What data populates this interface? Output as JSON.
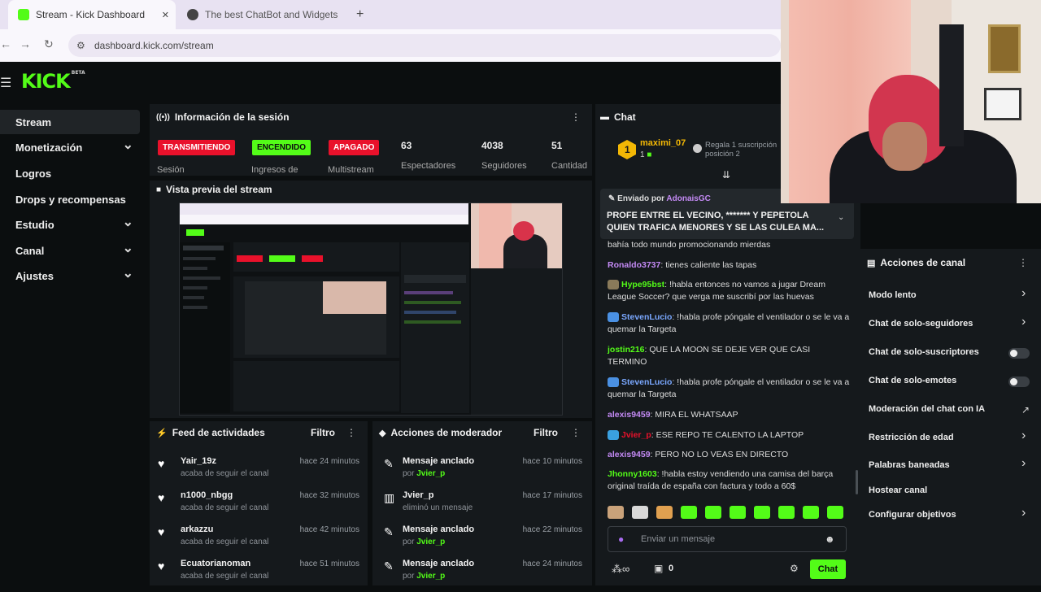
{
  "browser": {
    "tabs": [
      {
        "label": "Stream - Kick Dashboard",
        "active": true
      },
      {
        "label": "The best ChatBot and Widgets",
        "active": false
      }
    ],
    "new_tab": "+",
    "close": "✕",
    "url": "dashboard.kick.com/stream"
  },
  "kick": {
    "logo": "KICK",
    "logo_sup": "BETA"
  },
  "sidebar": {
    "items": [
      {
        "label": "Stream",
        "selected": true,
        "chevron": false
      },
      {
        "label": "Monetización",
        "chevron": true
      },
      {
        "label": "Logros",
        "chevron": false
      },
      {
        "label": "Drops y recompensas",
        "chevron": false
      },
      {
        "label": "Estudio",
        "chevron": true
      },
      {
        "label": "Canal",
        "chevron": true
      },
      {
        "label": "Ajustes",
        "chevron": true
      }
    ]
  },
  "session": {
    "title": "Información de la sesión",
    "badges": [
      {
        "label": "TRANSMITIENDO",
        "color": "#e9112b",
        "text_color": "#ffffff"
      },
      {
        "label": "ENCENDIDO",
        "color": "#53fc18",
        "text_color": "#0b0e0f"
      },
      {
        "label": "APAGADO",
        "color": "#e9112b",
        "text_color": "#ffffff"
      }
    ],
    "badge_labels": [
      "Sesión",
      "Ingresos de",
      "Multistream"
    ],
    "stats": [
      {
        "value": "63",
        "label": "Espectadores"
      },
      {
        "value": "4038",
        "label": "Seguidores"
      },
      {
        "value": "51",
        "label": "Cantidad"
      }
    ]
  },
  "preview": {
    "title": "Vista previa del stream"
  },
  "activity": {
    "title": "Feed de actividades",
    "filter": "Filtro",
    "items": [
      {
        "name": "Yair_19z",
        "sub": "acaba de seguir el canal",
        "time": "hace 24 minutos"
      },
      {
        "name": "n1000_nbgg",
        "sub": "acaba de seguir el canal",
        "time": "hace 32 minutos"
      },
      {
        "name": "arkazzu",
        "sub": "acaba de seguir el canal",
        "time": "hace 42 minutos"
      },
      {
        "name": "Ecuatorianoman",
        "sub": "acaba de seguir el canal",
        "time": "hace 51 minutos"
      }
    ]
  },
  "modactions": {
    "title": "Acciones de moderador",
    "filter": "Filtro",
    "items": [
      {
        "name": "Mensaje anclado",
        "prefix": "por ",
        "user": "Jvier_p",
        "sub": "",
        "time": "hace 10 minutos",
        "icon": "pin-icon"
      },
      {
        "name": "Jvier_p",
        "prefix": "",
        "user": "",
        "sub": "eliminó un mensaje",
        "time": "hace 17 minutos",
        "icon": "trash-icon"
      },
      {
        "name": "Mensaje anclado",
        "prefix": "por ",
        "user": "Jvier_p",
        "sub": "",
        "time": "hace 22 minutos",
        "icon": "pin-icon"
      },
      {
        "name": "Mensaje anclado",
        "prefix": "por ",
        "user": "Jvier_p",
        "sub": "",
        "time": "hace 24 minutos",
        "icon": "pin-icon"
      }
    ]
  },
  "chat": {
    "title": "Chat",
    "gifter": {
      "name": "maximi_07",
      "count": "1",
      "note": "Regala 1 suscripción",
      "note2": "posición 2"
    },
    "pinned": {
      "label": "Enviado por",
      "user": "AdonaisGC",
      "text": "PROFE ENTRE EL VECINO, ******* Y PEPETOLA QUIEN TRAFICA MENORES Y SE LAS CULEA MA..."
    },
    "messages": [
      {
        "user": "",
        "color": "#dddddd",
        "text": "bahía todo mundo promocionando mierdas"
      },
      {
        "user": "Ronaldo3737",
        "color": "#c48af5",
        "text": "tienes caliente las tapas"
      },
      {
        "user": "Hype95bst",
        "color": "#53fc18",
        "text": "!habla entonces no vamos a jugar Dream League Soccer? que verga me suscribí por las huevas"
      },
      {
        "user": "StevenLucio",
        "color": "#7aa8ff",
        "text": "!habla profe póngale el ventilador o se le va a quemar la Targeta"
      },
      {
        "user": "jostin216",
        "color": "#53fc18",
        "text": "QUE LA MOON SE DEJE VER QUE CASI TERMINO"
      },
      {
        "user": "StevenLucio",
        "color": "#7aa8ff",
        "text": "!habla profe póngale el ventilador o se le va a quemar la Targeta"
      },
      {
        "user": "alexis9459",
        "color": "#c48af5",
        "text": "MIRA EL WHATSAAP"
      },
      {
        "user": "Jvier_p",
        "color": "#e9112b",
        "text": "ESE REPO TE CALENTO LA LAPTOP"
      },
      {
        "user": "alexis9459",
        "color": "#c48af5",
        "text": "PERO NO LO VEAS EN DIRECTO"
      },
      {
        "user": "Jhonny1603",
        "color": "#53fc18",
        "text": "!habla estoy vendiendo una camisa del barça original traída de españa con factura y todo a 60$"
      }
    ],
    "input_placeholder": "Enviar un mensaje",
    "points": "0",
    "send": "Chat"
  },
  "channel_actions": {
    "title": "Acciones de canal",
    "items": [
      {
        "label": "Modo lento",
        "kind": "chevron"
      },
      {
        "label": "Chat de solo-seguidores",
        "kind": "chevron"
      },
      {
        "label": "Chat de solo-suscriptores",
        "kind": "toggle"
      },
      {
        "label": "Chat de solo-emotes",
        "kind": "toggle"
      },
      {
        "label": "Moderación del chat con IA",
        "kind": "external"
      },
      {
        "label": "Restricción de edad",
        "kind": "chevron"
      },
      {
        "label": "Palabras baneadas",
        "kind": "chevron"
      },
      {
        "label": "Hostear canal",
        "kind": "none"
      },
      {
        "label": "Configurar objetivos",
        "kind": "chevron"
      }
    ]
  },
  "colors": {
    "kick_green": "#53fc18",
    "live_red": "#e9112b",
    "panel": "#15191c",
    "bg": "#0b0e0f"
  }
}
